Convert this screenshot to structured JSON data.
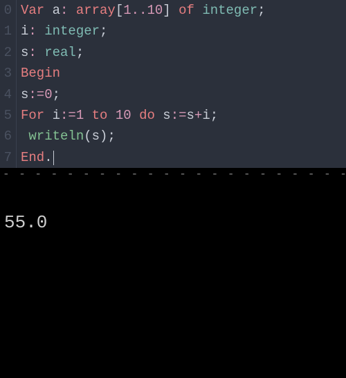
{
  "editor": {
    "lines": [
      {
        "num": "0",
        "tokens": [
          {
            "t": "Var ",
            "c": "kw"
          },
          {
            "t": "a",
            "c": "ident"
          },
          {
            "t": ":",
            "c": "op"
          },
          {
            "t": " ",
            "c": "ident"
          },
          {
            "t": "array",
            "c": "kw"
          },
          {
            "t": "[",
            "c": "punc"
          },
          {
            "t": "1",
            "c": "num"
          },
          {
            "t": "..",
            "c": "op"
          },
          {
            "t": "10",
            "c": "num"
          },
          {
            "t": "]",
            "c": "punc"
          },
          {
            "t": " ",
            "c": "ident"
          },
          {
            "t": "of ",
            "c": "kw"
          },
          {
            "t": "integer",
            "c": "type"
          },
          {
            "t": ";",
            "c": "punc"
          }
        ]
      },
      {
        "num": "1",
        "tokens": [
          {
            "t": "i",
            "c": "ident"
          },
          {
            "t": ":",
            "c": "op"
          },
          {
            "t": " ",
            "c": "ident"
          },
          {
            "t": "integer",
            "c": "type"
          },
          {
            "t": ";",
            "c": "punc"
          }
        ]
      },
      {
        "num": "2",
        "tokens": [
          {
            "t": "s",
            "c": "ident"
          },
          {
            "t": ":",
            "c": "op"
          },
          {
            "t": " ",
            "c": "ident"
          },
          {
            "t": "real",
            "c": "type"
          },
          {
            "t": ";",
            "c": "punc"
          }
        ]
      },
      {
        "num": "3",
        "tokens": [
          {
            "t": "Begin",
            "c": "kw"
          }
        ]
      },
      {
        "num": "4",
        "tokens": [
          {
            "t": "s",
            "c": "ident"
          },
          {
            "t": ":=",
            "c": "op"
          },
          {
            "t": "0",
            "c": "num"
          },
          {
            "t": ";",
            "c": "punc"
          }
        ]
      },
      {
        "num": "5",
        "tokens": [
          {
            "t": "For ",
            "c": "kw"
          },
          {
            "t": "i",
            "c": "ident"
          },
          {
            "t": ":=",
            "c": "op"
          },
          {
            "t": "1",
            "c": "num"
          },
          {
            "t": " ",
            "c": "ident"
          },
          {
            "t": "to ",
            "c": "kw"
          },
          {
            "t": "10",
            "c": "num"
          },
          {
            "t": " ",
            "c": "ident"
          },
          {
            "t": "do ",
            "c": "kw"
          },
          {
            "t": "s",
            "c": "ident"
          },
          {
            "t": ":=",
            "c": "op"
          },
          {
            "t": "s",
            "c": "ident"
          },
          {
            "t": "+",
            "c": "op"
          },
          {
            "t": "i",
            "c": "ident"
          },
          {
            "t": ";",
            "c": "punc"
          }
        ]
      },
      {
        "num": "6",
        "tokens": [
          {
            "t": " ",
            "c": "ident"
          },
          {
            "t": "writeln",
            "c": "func"
          },
          {
            "t": "(",
            "c": "punc"
          },
          {
            "t": "s",
            "c": "ident"
          },
          {
            "t": ")",
            "c": "punc"
          },
          {
            "t": ";",
            "c": "punc"
          }
        ]
      },
      {
        "num": "7",
        "tokens": [
          {
            "t": "End",
            "c": "kw"
          },
          {
            "t": ".",
            "c": "punc"
          }
        ],
        "cursor": true
      }
    ]
  },
  "divider": "- - - - - - - - - - - - - - - - - - - - - - - - - - - - - - - - - - - -",
  "terminal": {
    "output": "55.0"
  }
}
